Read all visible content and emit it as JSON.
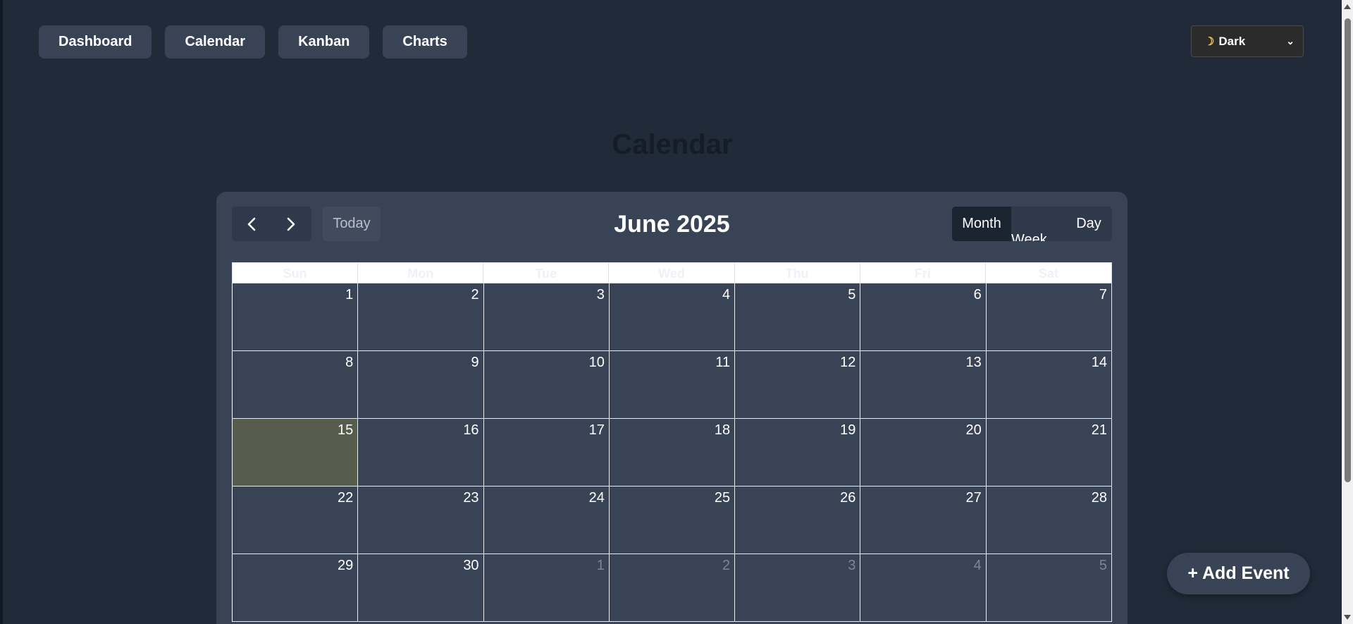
{
  "nav": {
    "items": [
      {
        "label": "Dashboard"
      },
      {
        "label": "Calendar"
      },
      {
        "label": "Kanban"
      },
      {
        "label": "Charts"
      }
    ]
  },
  "theme": {
    "icon": "moon-icon",
    "selected": "Dark"
  },
  "page": {
    "title": "Calendar"
  },
  "calendar": {
    "title": "June 2025",
    "today_label": "Today",
    "views": [
      "Month",
      "Week",
      "Day"
    ],
    "active_view": "Month",
    "weekdays": [
      "Sun",
      "Mon",
      "Tue",
      "Wed",
      "Thu",
      "Fri",
      "Sat"
    ],
    "today_date": "15",
    "weeks": [
      [
        "1",
        "2",
        "3",
        "4",
        "5",
        "6",
        "7"
      ],
      [
        "8",
        "9",
        "10",
        "11",
        "12",
        "13",
        "14"
      ],
      [
        "15",
        "16",
        "17",
        "18",
        "19",
        "20",
        "21"
      ],
      [
        "22",
        "23",
        "24",
        "25",
        "26",
        "27",
        "28"
      ],
      [
        "29",
        "30",
        "1",
        "2",
        "3",
        "4",
        "5"
      ]
    ]
  },
  "fab": {
    "label": "+ Add Event"
  },
  "colors": {
    "background": "#212a39",
    "card": "#394356",
    "today_highlight": "#575c4d",
    "button": "#384355"
  }
}
